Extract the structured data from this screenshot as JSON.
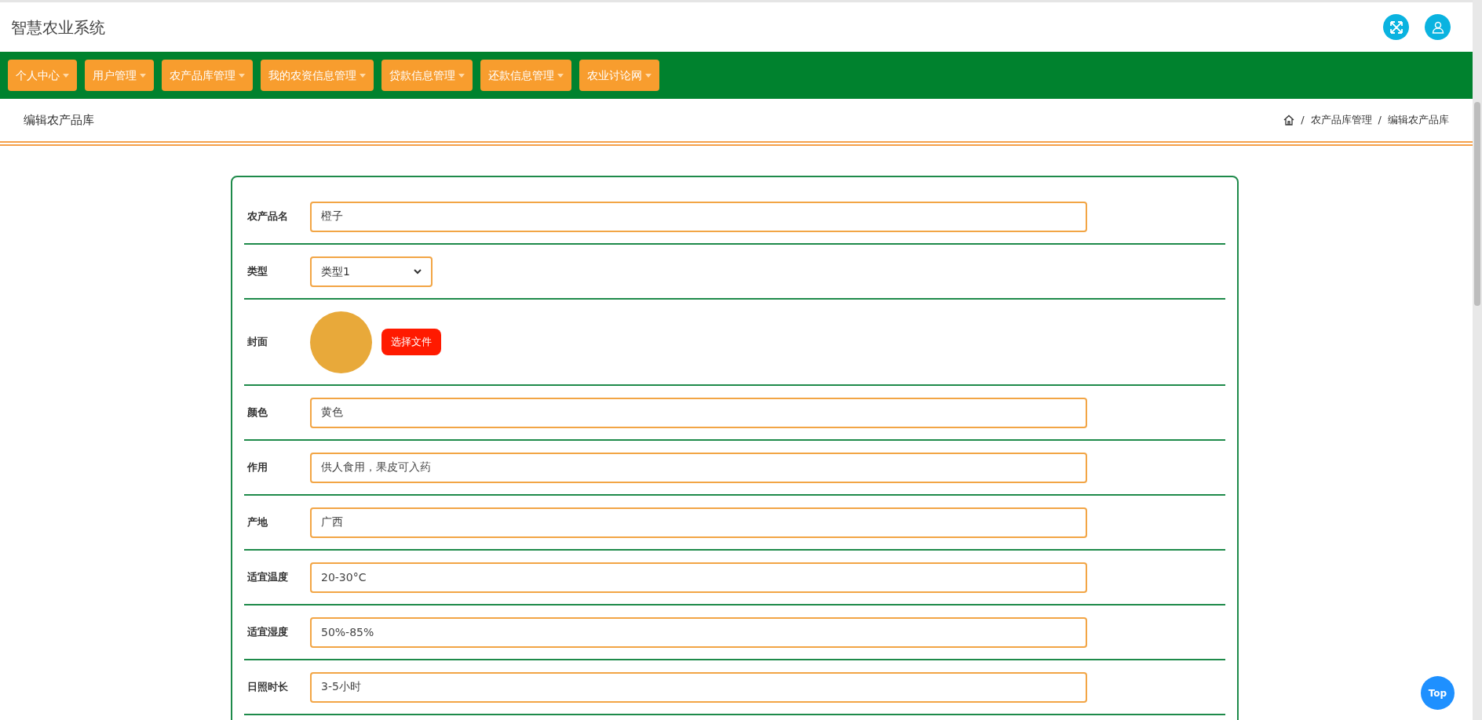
{
  "header": {
    "title": "智慧农业系统"
  },
  "nav": [
    {
      "label": "个人中心"
    },
    {
      "label": "用户管理"
    },
    {
      "label": "农产品库管理"
    },
    {
      "label": "我的农资信息管理"
    },
    {
      "label": "贷款信息管理"
    },
    {
      "label": "还款信息管理"
    },
    {
      "label": "农业讨论网"
    }
  ],
  "page_title": "编辑农产品库",
  "breadcrumb": [
    "农产品库管理",
    "编辑农产品库"
  ],
  "breadcrumb_separator": "/",
  "form": [
    {
      "kind": "text",
      "label": "农产品名",
      "value": "橙子"
    },
    {
      "kind": "select",
      "label": "类型",
      "value": "类型1"
    },
    {
      "kind": "image",
      "label": "封面",
      "button": "选择文件"
    },
    {
      "kind": "text",
      "label": "颜色",
      "value": "黄色"
    },
    {
      "kind": "text",
      "label": "作用",
      "value": "供人食用，果皮可入药"
    },
    {
      "kind": "text",
      "label": "产地",
      "value": "广西"
    },
    {
      "kind": "text",
      "label": "适宜温度",
      "value": "20-30°C"
    },
    {
      "kind": "text",
      "label": "适宜湿度",
      "value": "50%-85%"
    },
    {
      "kind": "text",
      "label": "日照时长",
      "value": "3-5小时"
    }
  ],
  "top_button": "Top"
}
